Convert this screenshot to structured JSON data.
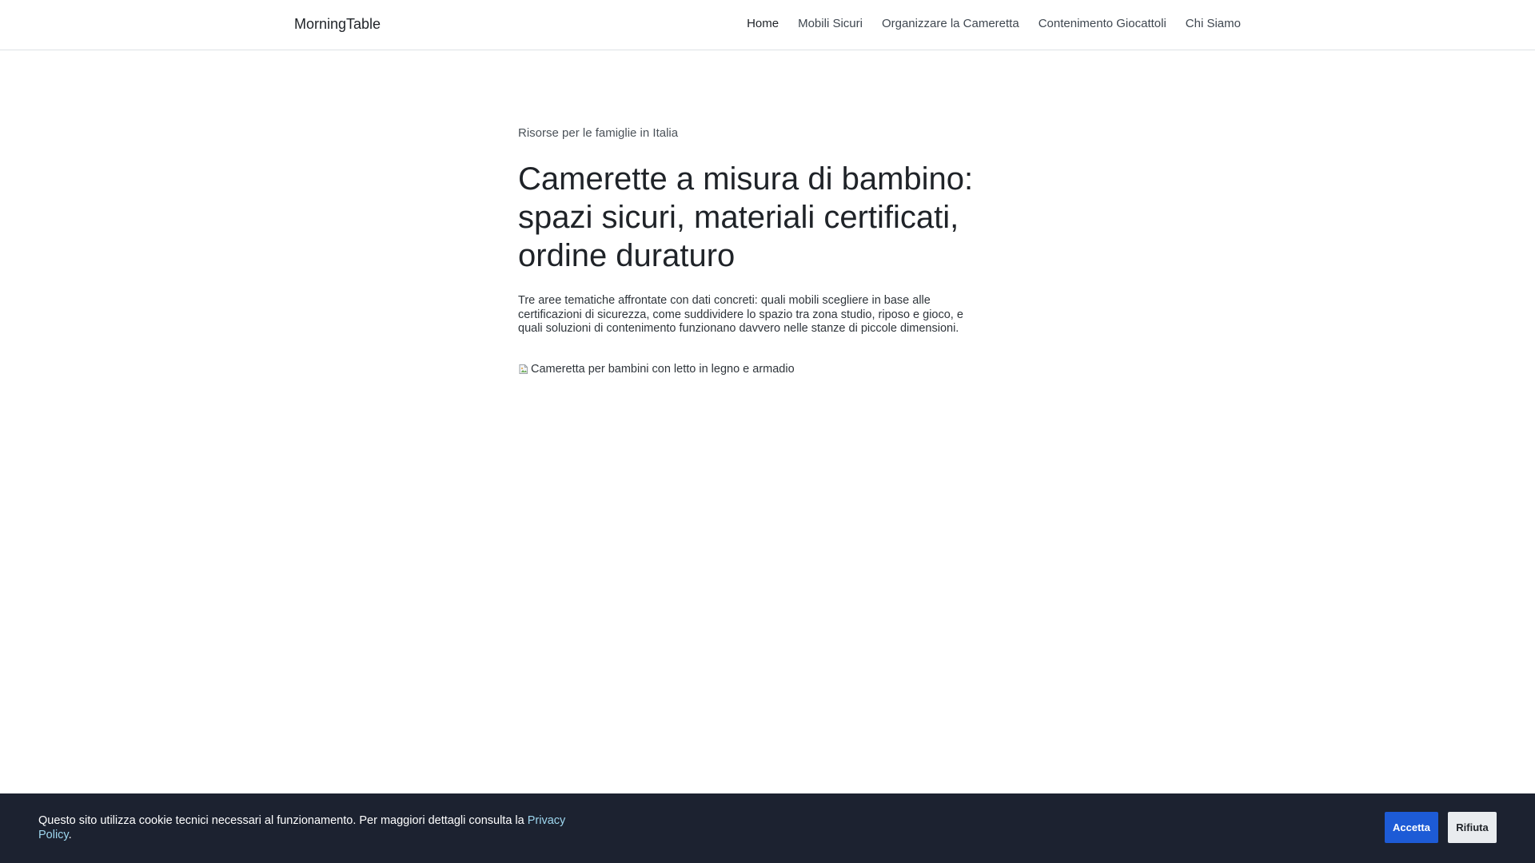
{
  "header": {
    "brand": "MorningTable",
    "nav": [
      {
        "label": "Home",
        "active": true
      },
      {
        "label": "Mobili Sicuri"
      },
      {
        "label": "Organizzare la Cameretta"
      },
      {
        "label": "Contenimento Giocattoli"
      },
      {
        "label": "Chi Siamo"
      }
    ]
  },
  "hero": {
    "eyebrow": "Risorse per le famiglie in Italia",
    "title": "Camerette a misura di bambino: spazi sicuri, materiali certificati, ordine duraturo",
    "lead": "Tre aree tematiche affrontate con dati concreti: quali mobili scegliere in base alle certificazioni di sicurezza, come suddividere lo spazio tra zona studio, riposo e gioco, e quali soluzioni di contenimento funzionano davvero nelle stanze di piccole dimensioni.",
    "image_alt": "Cameretta per bambini con letto in legno e armadio",
    "image_icon": "broken-image-icon"
  },
  "cookie": {
    "text_prefix": "Questo sito utilizza cookie tecnici necessari al funzionamento. Per maggiori dettagli consulta la ",
    "link_label": "Privacy Policy",
    "text_suffix": ".",
    "accept_label": "Accetta",
    "reject_label": "Rifiuta"
  },
  "colors": {
    "cookie_bg": "#1c2230",
    "accept_bg": "#1d5bd6",
    "reject_bg": "#e9ecef",
    "link": "#9ed7ef"
  }
}
